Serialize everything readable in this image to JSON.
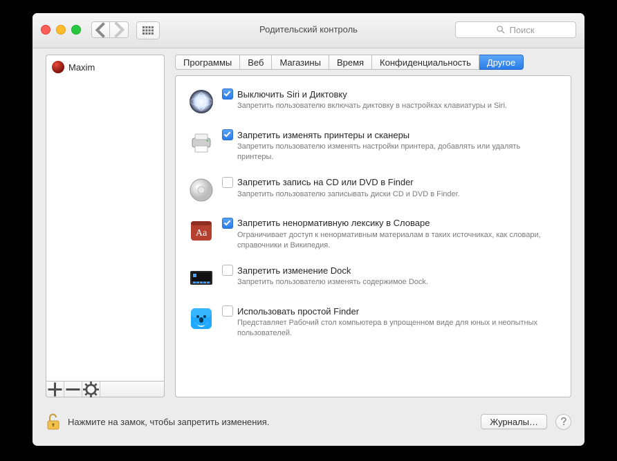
{
  "window_title": "Родительский контроль",
  "search_placeholder": "Поиск",
  "user_name": "Maxim",
  "tabs": [
    "Программы",
    "Веб",
    "Магазины",
    "Время",
    "Конфиденциальность",
    "Другое"
  ],
  "active_tab": 5,
  "options": [
    {
      "checked": true,
      "title": "Выключить Siri и Диктовку",
      "desc": "Запретить пользователю включать диктовку в настройках клавиатуры и Siri."
    },
    {
      "checked": true,
      "title": "Запретить изменять принтеры и сканеры",
      "desc": "Запретить пользователю изменять настройки принтера, добавлять или удалять принтеры."
    },
    {
      "checked": false,
      "title": "Запретить запись на CD или DVD в Finder",
      "desc": "Запретить пользователю записывать диски CD и DVD в Finder."
    },
    {
      "checked": true,
      "title": "Запретить ненормативную лексику в Словаре",
      "desc": "Ограничивает доступ к ненормативным материалам в таких источниках, как словари, справочники и Википедия."
    },
    {
      "checked": false,
      "title": "Запретить изменение Dock",
      "desc": "Запретить пользователю изменять содержимое Dock."
    },
    {
      "checked": false,
      "title": "Использовать простой Finder",
      "desc": "Представляет Рабочий стол компьютера в упрощенном виде для юных и неопытных пользователей."
    }
  ],
  "lock_message": "Нажмите на замок, чтобы запретить изменения.",
  "logs_button": "Журналы…",
  "sidebar_buttons": {
    "add": "+",
    "remove": "−",
    "gear": "✻"
  }
}
